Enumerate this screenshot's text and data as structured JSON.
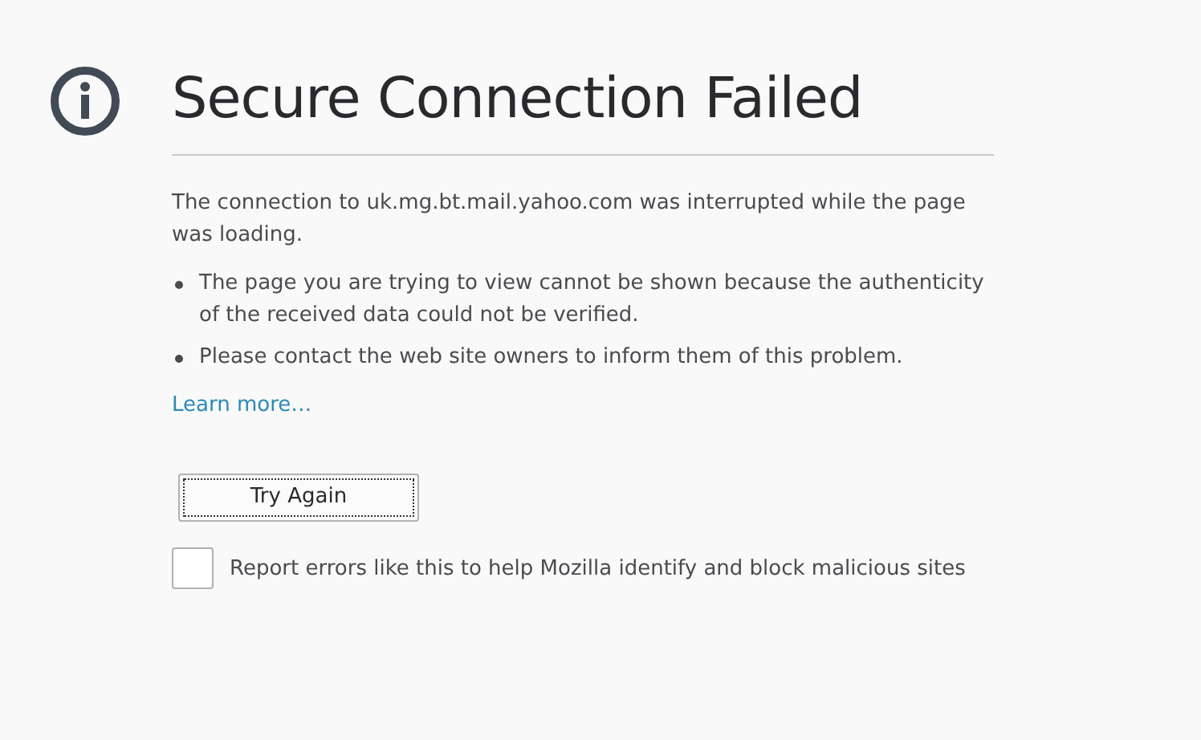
{
  "title": "Secure Connection Failed",
  "description": "The connection to uk.mg.bt.mail.yahoo.com was interrupted while the page was loading.",
  "bullets": [
    "The page you are trying to view cannot be shown because the authenticity of the received data could not be verified.",
    "Please contact the web site owners to inform them of this problem."
  ],
  "learn_more": "Learn more…",
  "button": {
    "label": "Try Again"
  },
  "report": {
    "label": "Report errors like this to help Mozilla identify and block malicious sites",
    "checked": false
  }
}
